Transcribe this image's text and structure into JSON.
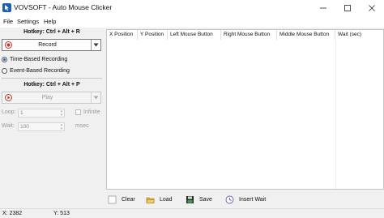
{
  "window": {
    "title": "VOVSOFT - Auto Mouse Clicker",
    "controls": [
      "minimize-icon",
      "maximize-icon",
      "close-icon"
    ]
  },
  "menu": {
    "items": [
      "File",
      "Settings",
      "Help"
    ]
  },
  "left_panel": {
    "record_hotkey": "Hotkey: Ctrl + Alt + R",
    "record_button": "Record",
    "recording_modes": [
      {
        "label": "Time-Based Recording",
        "selected": true
      },
      {
        "label": "Event-Based Recording",
        "selected": false
      }
    ],
    "play_hotkey": "Hotkey: Ctrl + Alt + P",
    "play_button": "Play",
    "loop": {
      "label": "Loop:",
      "value": "1"
    },
    "infinite": {
      "label": "Infinite",
      "checked": false
    },
    "wait": {
      "label": "Wait:",
      "value": "100",
      "unit": "msec"
    }
  },
  "grid": {
    "columns": [
      "X Position",
      "Y Position",
      "Left Mouse Button",
      "Right Mouse Button",
      "Middle Mouse Button",
      "Wait (sec)"
    ],
    "rows": []
  },
  "bottom_buttons": [
    {
      "label": "Clear",
      "icon": "clear-icon"
    },
    {
      "label": "Load",
      "icon": "folder-open-icon"
    },
    {
      "label": "Save",
      "icon": "floppy-disk-icon"
    },
    {
      "label": "Insert Wait",
      "icon": "clock-icon"
    }
  ],
  "status": {
    "x": "X: 2382",
    "y": "Y: 513"
  },
  "colors": {
    "record_red": "#c0392b",
    "accent_blue": "#1a5fb4"
  }
}
